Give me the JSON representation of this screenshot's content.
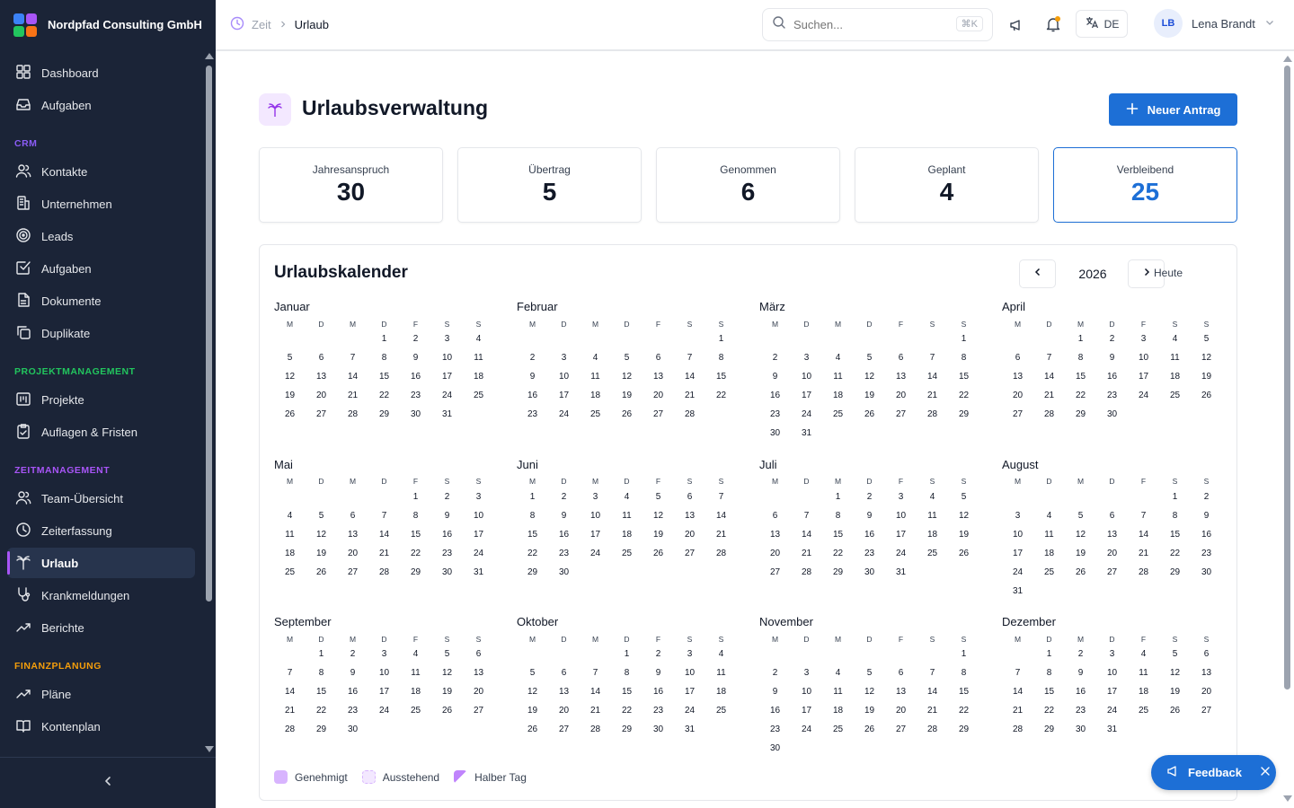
{
  "app": {
    "name": "Nordpfad Consulting GmbH"
  },
  "colors": {
    "sidebar_bg": "#1b2437",
    "accent": "#1d6fd6",
    "active_marker": "#a855f7",
    "logo": [
      "#3b82f6",
      "#a855f7",
      "#22c55e",
      "#f97316"
    ]
  },
  "sidebar": {
    "items_top": [
      {
        "name": "dashboard",
        "label": "Dashboard",
        "icon": "grid-icon"
      },
      {
        "name": "aufgaben",
        "label": "Aufgaben",
        "icon": "inbox-icon"
      }
    ],
    "sections": [
      {
        "label": "CRM",
        "color": "#8b5cf6",
        "items": [
          {
            "name": "kontakte",
            "label": "Kontakte",
            "icon": "users-icon"
          },
          {
            "name": "unternehmen",
            "label": "Unternehmen",
            "icon": "building-icon"
          },
          {
            "name": "leads",
            "label": "Leads",
            "icon": "target-icon"
          },
          {
            "name": "crm-aufgaben",
            "label": "Aufgaben",
            "icon": "checkbox-icon"
          },
          {
            "name": "dokumente",
            "label": "Dokumente",
            "icon": "document-icon"
          },
          {
            "name": "duplikate",
            "label": "Duplikate",
            "icon": "copy-icon"
          }
        ]
      },
      {
        "label": "PROJEKTMANAGEMENT",
        "color": "#22c55e",
        "items": [
          {
            "name": "projekte",
            "label": "Projekte",
            "icon": "kanban-icon"
          },
          {
            "name": "auflagen",
            "label": "Auflagen & Fristen",
            "icon": "clipboard-check-icon"
          }
        ]
      },
      {
        "label": "ZEITMANAGEMENT",
        "color": "#a855f7",
        "items": [
          {
            "name": "team-uebersicht",
            "label": "Team-Übersicht",
            "icon": "users-icon"
          },
          {
            "name": "zeiterfassung",
            "label": "Zeiterfassung",
            "icon": "clock-icon"
          },
          {
            "name": "urlaub",
            "label": "Urlaub",
            "icon": "palm-tree-icon",
            "active": true
          },
          {
            "name": "krankmeldungen",
            "label": "Krankmeldungen",
            "icon": "stethoscope-icon"
          },
          {
            "name": "berichte",
            "label": "Berichte",
            "icon": "trend-icon"
          }
        ]
      },
      {
        "label": "FINANZPLANUNG",
        "color": "#f59e0b",
        "items": [
          {
            "name": "plaene",
            "label": "Pläne",
            "icon": "trend-icon"
          },
          {
            "name": "kontenplan",
            "label": "Kontenplan",
            "icon": "book-icon"
          }
        ]
      }
    ]
  },
  "topbar": {
    "breadcrumb": [
      "Zeit",
      "Urlaub"
    ],
    "search_placeholder": "Suchen...",
    "search_shortcut": "⌘K",
    "language": "DE",
    "user": {
      "initials": "LB",
      "name": "Lena Brandt"
    }
  },
  "page": {
    "title": "Urlaubsverwaltung",
    "new_button": "Neuer Antrag",
    "stats": [
      {
        "label": "Jahresanspruch",
        "value": "30"
      },
      {
        "label": "Übertrag",
        "value": "5"
      },
      {
        "label": "Genommen",
        "value": "6"
      },
      {
        "label": "Geplant",
        "value": "4"
      },
      {
        "label": "Verbleibend",
        "value": "25",
        "highlight": true
      }
    ]
  },
  "calendar": {
    "title": "Urlaubskalender",
    "year": "2026",
    "today_label": "Heute",
    "weekdays": [
      "M",
      "D",
      "M",
      "D",
      "F",
      "S",
      "S"
    ],
    "months": [
      {
        "name": "Januar",
        "offset": 3,
        "days": 31
      },
      {
        "name": "Februar",
        "offset": 6,
        "days": 28
      },
      {
        "name": "März",
        "offset": 6,
        "days": 31
      },
      {
        "name": "April",
        "offset": 2,
        "days": 30
      },
      {
        "name": "Mai",
        "offset": 4,
        "days": 31
      },
      {
        "name": "Juni",
        "offset": 0,
        "days": 30
      },
      {
        "name": "Juli",
        "offset": 2,
        "days": 31
      },
      {
        "name": "August",
        "offset": 5,
        "days": 31
      },
      {
        "name": "September",
        "offset": 1,
        "days": 30
      },
      {
        "name": "Oktober",
        "offset": 3,
        "days": 31
      },
      {
        "name": "November",
        "offset": 6,
        "days": 30
      },
      {
        "name": "Dezember",
        "offset": 1,
        "days": 31
      }
    ],
    "legend": [
      {
        "label": "Genehmigt",
        "color": "#d8b4fe"
      },
      {
        "label": "Ausstehend",
        "color": "#f3e8ff"
      },
      {
        "label": "Halber Tag",
        "color": "#c084fc"
      }
    ]
  },
  "feedback": {
    "label": "Feedback"
  }
}
